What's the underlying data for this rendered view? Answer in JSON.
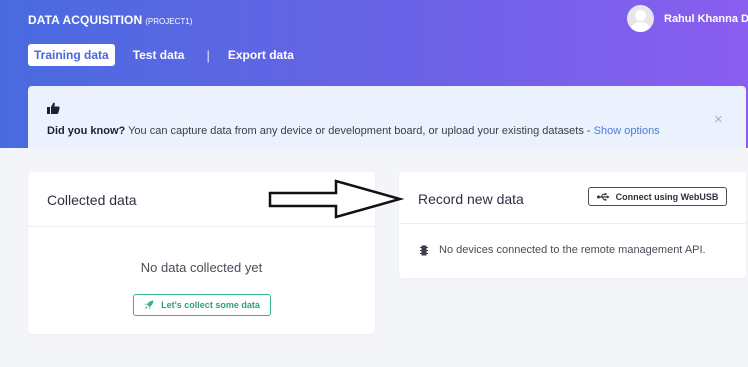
{
  "header": {
    "title": "DATA ACQUISITION",
    "project": "(PROJECT1)",
    "user_name": "Rahul Khanna D"
  },
  "tabs": [
    {
      "label": "Training data",
      "active": true
    },
    {
      "label": "Test data",
      "active": false
    },
    {
      "label": "Export data",
      "active": false
    }
  ],
  "tab_separator": "|",
  "banner": {
    "icon": "thumbs-up-icon",
    "bold": "Did you know?",
    "text": " You can capture data from any device or development board, or upload your existing datasets - ",
    "link": "Show options",
    "close": "×"
  },
  "collected": {
    "title": "Collected data",
    "icon": "upload-icon",
    "empty_text": "No data collected yet",
    "button_label": "Let's collect some data",
    "button_icon": "rocket-icon"
  },
  "record": {
    "title": "Record new data",
    "button_label": "Connect using WebUSB",
    "button_icon": "usb-icon",
    "status_icon": "chip-icon",
    "status_text": "No devices connected to the remote management API."
  },
  "colors": {
    "header_start": "#4a6be0",
    "header_end": "#8a5ef0",
    "banner_bg": "#ecf2fd",
    "link": "#4a7fd6",
    "success": "#36b58a",
    "page_bg": "#f4f5f9"
  }
}
